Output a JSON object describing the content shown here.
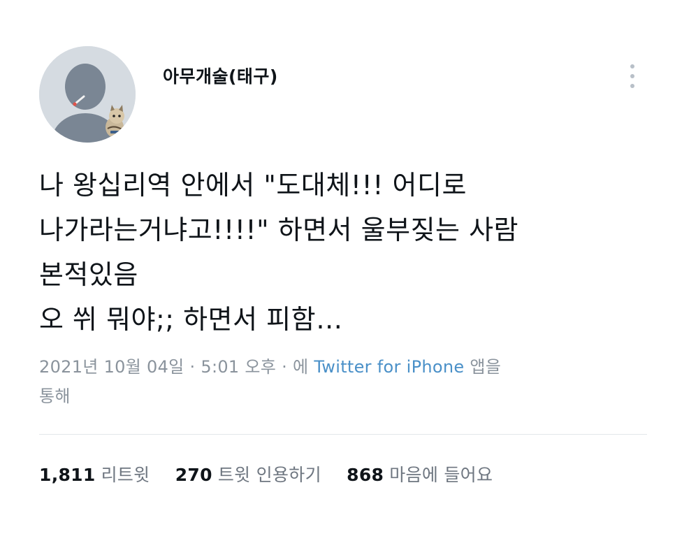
{
  "tweet": {
    "author": {
      "display_name": "아무개술(태구)"
    },
    "text_lines": [
      "나 왕십리역 안에서 \"도대체!!! 어디로",
      "나가라는거냐고!!!!\" 하면서 울부짖는 사람",
      "본적있음",
      "오 쒸 뭐야;; 하면서 피함…"
    ],
    "meta": {
      "date": "2021년 10월 04일",
      "separator": "·",
      "time": "5:01 오후",
      "source_prefix": "에",
      "source": "Twitter for iPhone",
      "source_suffix_1": "앱을",
      "source_suffix_2": "통해"
    },
    "stats": {
      "retweets_count": "1,811",
      "retweets_label": "리트윗",
      "quotes_count": "270",
      "quotes_label": "트윗 인용하기",
      "likes_count": "868",
      "likes_label": "마음에 들어요"
    }
  },
  "colors": {
    "text": "#0f1419",
    "muted": "#8a939c",
    "link": "#4a90c8",
    "avatar_bg": "#d5dbe1",
    "avatar_figure": "#7a8694"
  },
  "icons": {
    "more": "more-vertical-icon"
  }
}
